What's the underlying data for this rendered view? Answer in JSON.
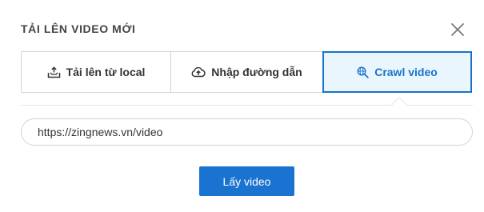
{
  "dialog": {
    "title": "TẢI LÊN VIDEO MỚI",
    "close_icon": "close-icon"
  },
  "tabs": [
    {
      "label": "Tải lên từ local",
      "icon": "upload-tray-icon",
      "active": false
    },
    {
      "label": "Nhập đường dẫn",
      "icon": "cloud-upload-icon",
      "active": false
    },
    {
      "label": "Crawl video",
      "icon": "globe-search-icon",
      "active": true
    }
  ],
  "colors": {
    "accent": "#1a73d0",
    "active_tab_bg": "#eaf6fd",
    "border": "#d3d3d3"
  },
  "url_field": {
    "value": "https://zingnews.vn/video",
    "placeholder": ""
  },
  "submit": {
    "label": "Lấy video"
  }
}
